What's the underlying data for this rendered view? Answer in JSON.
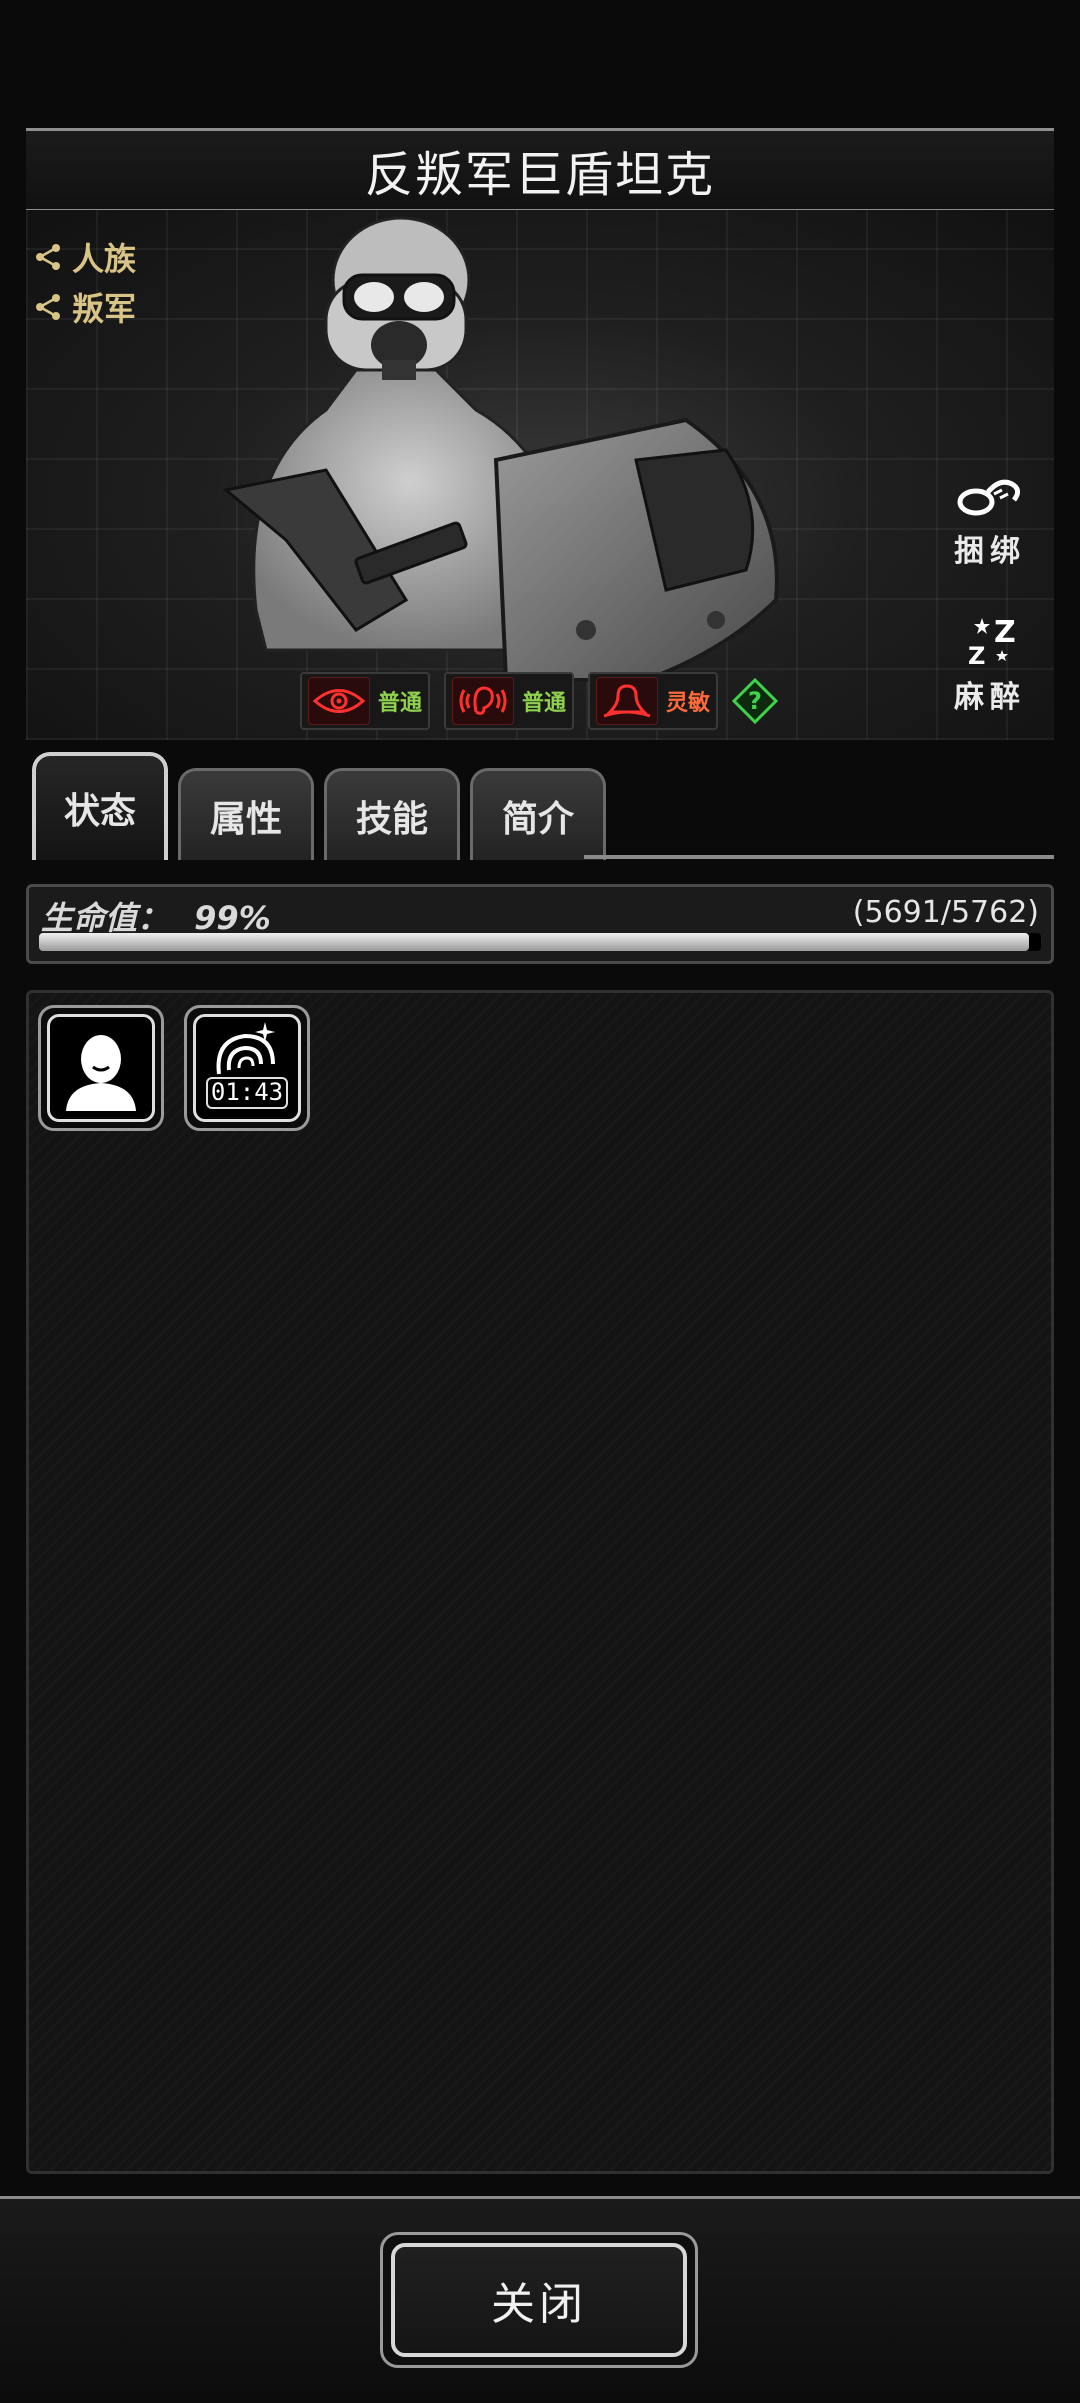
{
  "title": "反叛军巨盾坦克",
  "tags": [
    {
      "label": "人族",
      "icon": "share-icon"
    },
    {
      "label": "叛军",
      "icon": "share-icon"
    }
  ],
  "actions": [
    {
      "label": "捆绑",
      "icon": "rope-icon"
    },
    {
      "label": "麻醉",
      "icon": "sleep-icon"
    }
  ],
  "senses": [
    {
      "icon": "eye-icon",
      "label": "普通",
      "color": "#8fd14f"
    },
    {
      "icon": "ear-icon",
      "label": "普通",
      "color": "#8fd14f"
    },
    {
      "icon": "psychic-icon",
      "label": "灵敏",
      "color": "#ff6a3a"
    }
  ],
  "help_icon": "help-icon",
  "tabs": [
    {
      "label": "状态",
      "active": true
    },
    {
      "label": "属性",
      "active": false
    },
    {
      "label": "技能",
      "active": false
    },
    {
      "label": "简介",
      "active": false
    }
  ],
  "hp": {
    "label": "生命值：",
    "percent_text": "99%",
    "value_text": "(5691/5762)",
    "fraction": 0.988
  },
  "statuses": [
    {
      "icon": "human-icon"
    },
    {
      "icon": "dizzy-icon",
      "timer": "01:43"
    }
  ],
  "close_label": "关闭"
}
